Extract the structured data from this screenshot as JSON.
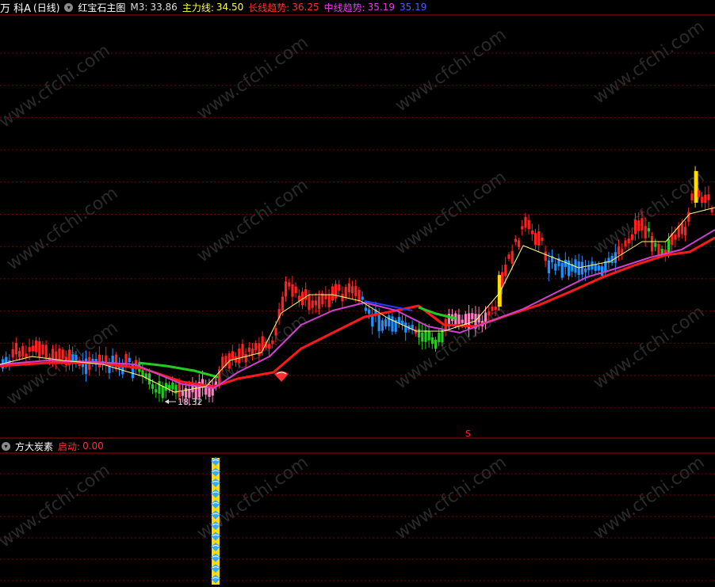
{
  "top_header": {
    "stock_name": "万 科A",
    "period": "(日线)",
    "indicator": "红宝石主图",
    "m3_label": "M3:",
    "m3_value": "33.86",
    "main_label": "主力线:",
    "main_value": "34.50",
    "long_label": "长线趋势:",
    "long_value": "36.25",
    "mid_label": "中线趋势:",
    "mid_value": "35.19",
    "extra_value": "35.19"
  },
  "low_price_label": "18.32",
  "s_marker": "S",
  "bottom_header": {
    "indicator": "方大炭素",
    "start_label": "启动:",
    "start_value": "0.00"
  },
  "watermark": "www.cfchi.com",
  "colors": {
    "background": "#000000",
    "up_candle": "#ff2020",
    "down_candle": "#1e90ff",
    "green_candle": "#22cc22",
    "pink_candle": "#ff80c0",
    "yellow_candle": "#ffdd00",
    "long_trend": "#ff1a1a",
    "mid_trend": "#d040d0",
    "short_line": "#ffff80",
    "grid": "#7a0000"
  },
  "icons": [
    "collapse-icon",
    "shield-signal-icon",
    "diamond-signal-icon"
  ]
}
